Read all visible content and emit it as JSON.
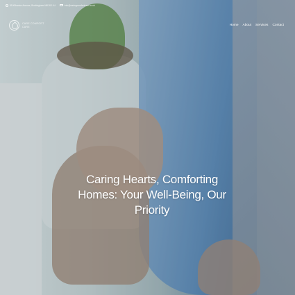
{
  "topbar": {
    "address": "55 Kilbartan Avenue, Buckingham MK18 1LU",
    "email": "info@caringcomfortcare.co.uk"
  },
  "brand": {
    "line1": "CARE COMFORT",
    "line2": "CARE"
  },
  "nav": {
    "items": [
      "Home",
      "About",
      "Services",
      "Contact"
    ]
  },
  "hero": {
    "headline": "Caring Hearts, Comforting Homes: Your Well-Being, Our Priority"
  }
}
